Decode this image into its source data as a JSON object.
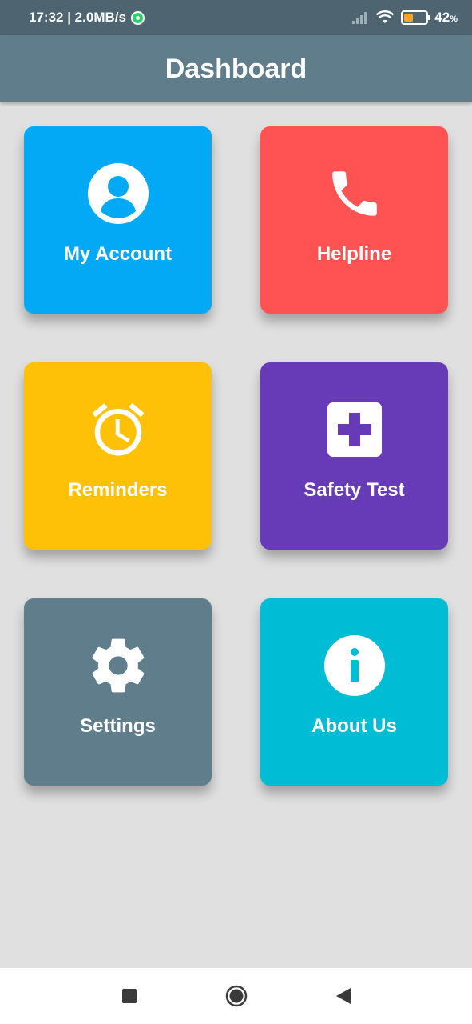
{
  "status_bar": {
    "time_speed": "17:32 | 2.0MB/s",
    "battery_percent": "42",
    "battery_unit": "%",
    "battery_level": 0.42
  },
  "app_bar": {
    "title": "Dashboard"
  },
  "tiles": [
    {
      "label": "My Account",
      "color": "#03a9f4",
      "icon": "account-circle-icon"
    },
    {
      "label": "Helpline",
      "color": "#ff5252",
      "icon": "phone-icon"
    },
    {
      "label": "Reminders",
      "color": "#ffc107",
      "icon": "alarm-clock-icon"
    },
    {
      "label": "Safety Test",
      "color": "#673ab7",
      "icon": "medical-plus-icon"
    },
    {
      "label": "Settings",
      "color": "#607d8b",
      "icon": "gear-icon"
    },
    {
      "label": "About Us",
      "color": "#00bcd4",
      "icon": "info-icon"
    }
  ],
  "nav_bar": {
    "buttons": [
      "recents-button",
      "home-button",
      "back-button"
    ]
  }
}
